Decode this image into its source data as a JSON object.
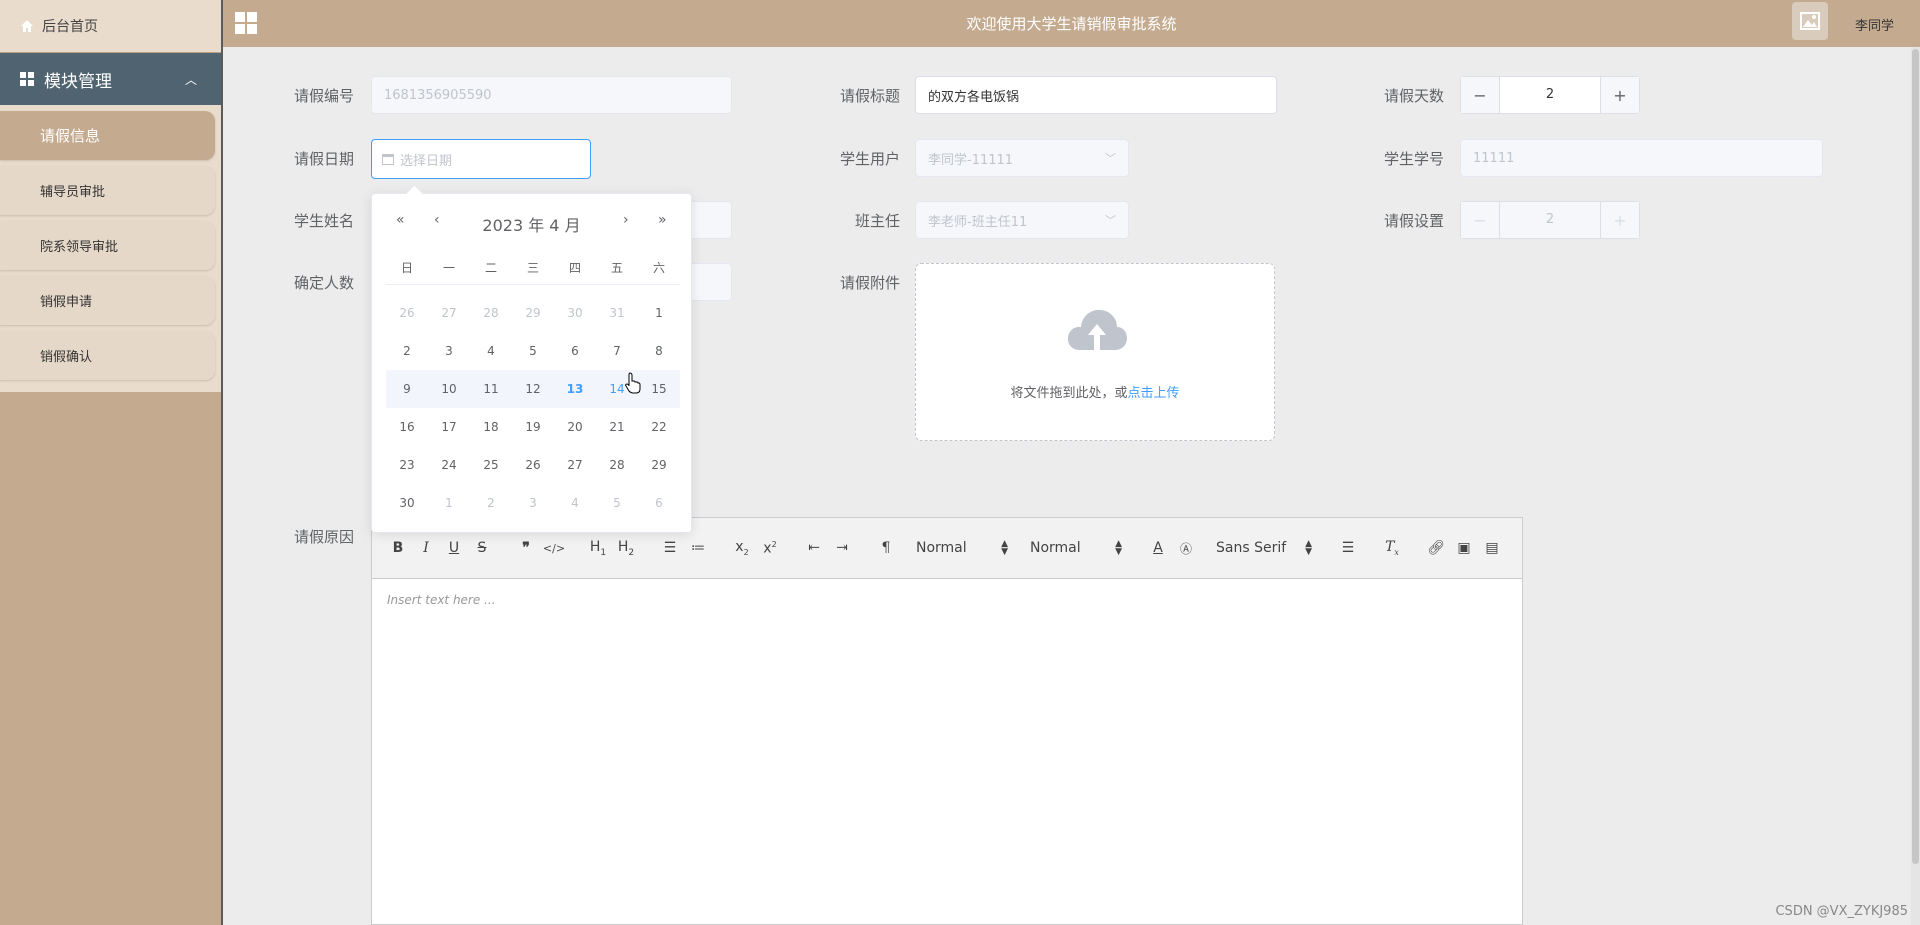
{
  "sidebar": {
    "home": "后台首页",
    "module": "模块管理",
    "items": [
      {
        "label": "请假信息"
      },
      {
        "label": "辅导员审批"
      },
      {
        "label": "院系领导审批"
      },
      {
        "label": "销假申请"
      },
      {
        "label": "销假确认"
      }
    ]
  },
  "header": {
    "title": "欢迎使用大学生请销假审批系统",
    "user": "李同学"
  },
  "form": {
    "leave_no": {
      "label": "请假编号",
      "value": "1681356905590"
    },
    "leave_title": {
      "label": "请假标题",
      "value": "的双方各电饭锅"
    },
    "leave_days": {
      "label": "请假天数",
      "value": "2",
      "minus": "−",
      "plus": "+"
    },
    "leave_date": {
      "label": "请假日期",
      "placeholder": "选择日期"
    },
    "student_user": {
      "label": "学生用户",
      "value": "李同学-11111"
    },
    "student_id": {
      "label": "学生学号",
      "value": "11111"
    },
    "student_name": {
      "label": "学生姓名"
    },
    "head_teacher": {
      "label": "班主任",
      "value": "李老师-班主任11"
    },
    "leave_setting": {
      "label": "请假设置",
      "value": "2",
      "minus": "−",
      "plus": "+"
    },
    "confirm_count": {
      "label": "确定人数"
    },
    "attachment": {
      "label": "请假附件",
      "text": "将文件拖到此处，或",
      "link": "点击上传"
    },
    "reason": {
      "label": "请假原因",
      "placeholder": "Insert text here ..."
    }
  },
  "editor": {
    "size_picker": "Normal",
    "header_picker": "Normal",
    "font_picker": "Sans Serif"
  },
  "datepicker": {
    "nav_prev_year": "«",
    "nav_prev_month": "‹",
    "nav_next_month": "›",
    "nav_next_year": "»",
    "year_month": "2023 年  4 月",
    "weekdays": [
      "日",
      "一",
      "二",
      "三",
      "四",
      "五",
      "六"
    ],
    "weeks": [
      [
        "26",
        "27",
        "28",
        "29",
        "30",
        "31",
        "1"
      ],
      [
        "2",
        "3",
        "4",
        "5",
        "6",
        "7",
        "8"
      ],
      [
        "9",
        "10",
        "11",
        "12",
        "13",
        "14",
        "15"
      ],
      [
        "16",
        "17",
        "18",
        "19",
        "20",
        "21",
        "22"
      ],
      [
        "23",
        "24",
        "25",
        "26",
        "27",
        "28",
        "29"
      ],
      [
        "30",
        "1",
        "2",
        "3",
        "4",
        "5",
        "6"
      ]
    ],
    "today": "13",
    "hovered": "14"
  },
  "watermark": "CSDN @VX_ZYKJ985"
}
